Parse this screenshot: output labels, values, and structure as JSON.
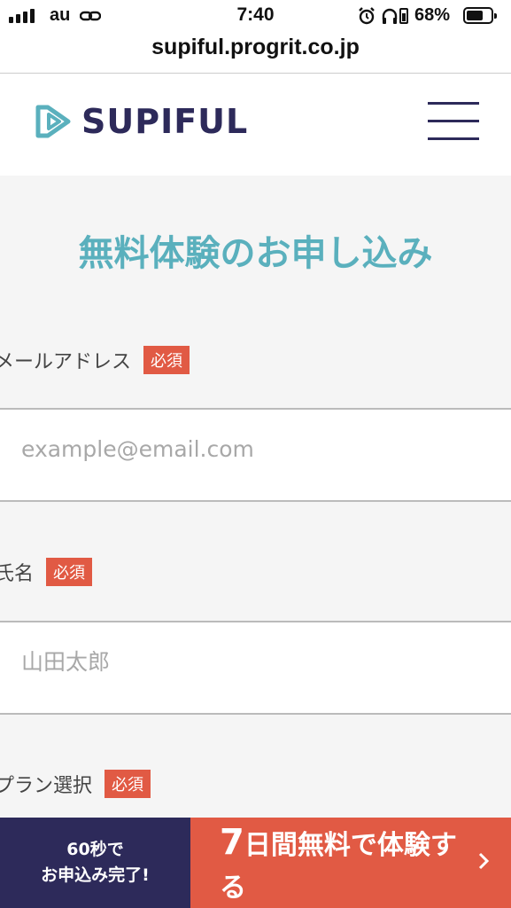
{
  "status": {
    "carrier": "au",
    "time": "7:40",
    "battery_pct": "68%",
    "battery_level": 0.68
  },
  "browser": {
    "url": "supiful.progrit.co.jp"
  },
  "header": {
    "brand": "SUPIFUL",
    "brand_color": "#2d2a5a",
    "accent_color": "#5ab0bd"
  },
  "form": {
    "title": "無料体験のお申し込み",
    "required_badge": "必須",
    "fields": [
      {
        "label": "メールアドレス",
        "placeholder": "example@email.com",
        "value": ""
      },
      {
        "label": "氏名",
        "placeholder": "山田太郎",
        "value": ""
      },
      {
        "label": "プラン選択"
      }
    ]
  },
  "bottom_bar": {
    "left_line1": "60秒で",
    "left_line2": "お申込み完了!",
    "cta_number": "7",
    "cta_text": "日間無料で体験する",
    "cta_color": "#e15a44"
  }
}
